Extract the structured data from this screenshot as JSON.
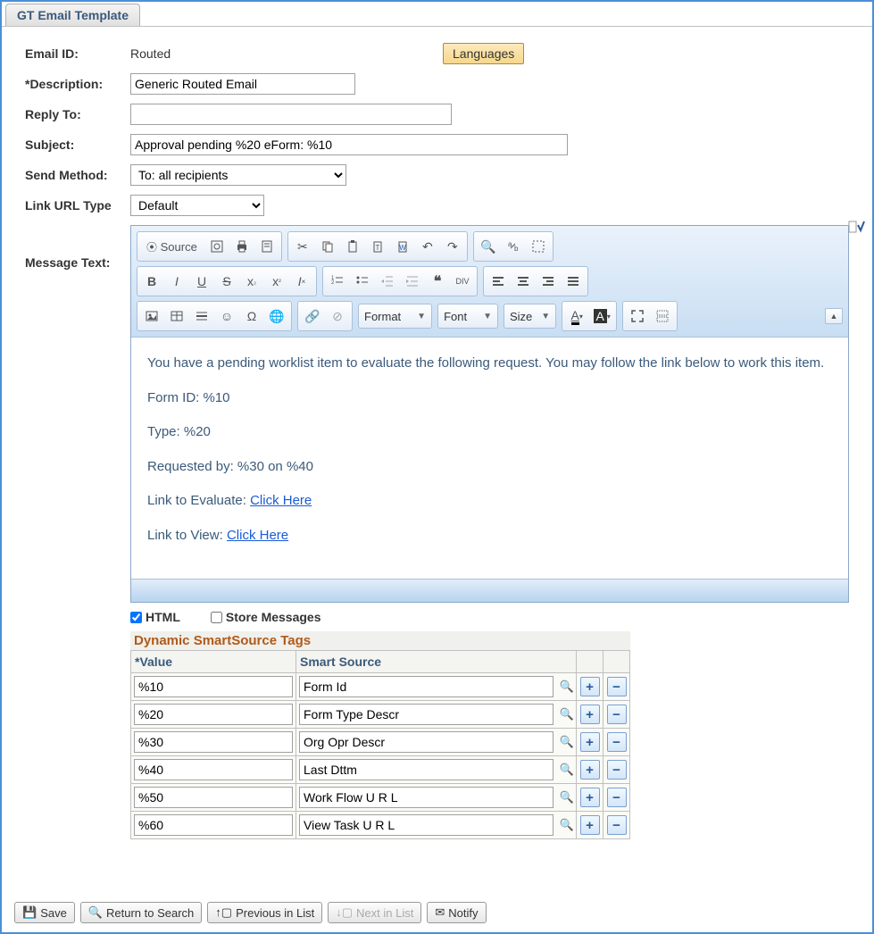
{
  "tab": {
    "title": "GT Email Template"
  },
  "form": {
    "email_id_label": "Email ID:",
    "email_id_value": "Routed",
    "languages_btn": "Languages",
    "description_label": "*Description:",
    "description_value": "Generic Routed Email",
    "reply_to_label": "Reply To:",
    "reply_to_value": "",
    "subject_label": "Subject:",
    "subject_value": "Approval pending %20 eForm: %10",
    "send_method_label": "Send Method:",
    "send_method_value": "To: all recipients",
    "link_url_type_label": "Link URL Type",
    "link_url_type_value": "Default",
    "message_text_label": "Message Text:"
  },
  "editor": {
    "source_label": "Source",
    "format_label": "Format",
    "font_label": "Font",
    "size_label": "Size",
    "body_intro": "You have a pending worklist item to evaluate the following request. You may follow the link below to work this item.",
    "body_formid": "Form ID: %10",
    "body_type": "Type: %20",
    "body_requested": "Requested by: %30 on %40",
    "body_link_eval_prefix": "Link to Evaluate: ",
    "body_link_view_prefix": "Link to View: ",
    "click_here": "Click Here"
  },
  "checks": {
    "html_label": "HTML",
    "html_checked": true,
    "store_label": "Store Messages",
    "store_checked": false
  },
  "smartsource": {
    "heading": "Dynamic SmartSource Tags",
    "col_value": "*Value",
    "col_source": "Smart Source",
    "rows": [
      {
        "value": "%10",
        "source": "Form Id"
      },
      {
        "value": "%20",
        "source": "Form Type Descr"
      },
      {
        "value": "%30",
        "source": "Org Opr Descr"
      },
      {
        "value": "%40",
        "source": "Last Dttm"
      },
      {
        "value": "%50",
        "source": "Work Flow U R L"
      },
      {
        "value": "%60",
        "source": "View Task U R L"
      }
    ]
  },
  "buttons": {
    "save": "Save",
    "return": "Return to Search",
    "previous": "Previous in List",
    "next": "Next in List",
    "notify": "Notify"
  }
}
